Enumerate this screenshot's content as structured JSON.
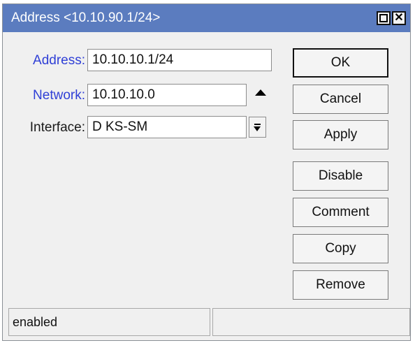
{
  "window": {
    "title": "Address <10.10.90.1/24>",
    "maximize_icon": "maximize-icon",
    "close_icon": "close-icon",
    "close_glyph": "✕"
  },
  "form": {
    "address": {
      "label": "Address:",
      "value": "10.10.10.1/24"
    },
    "network": {
      "label": "Network:",
      "value": "10.10.10.0",
      "toggle_icon": "triangle-up-icon"
    },
    "interface": {
      "label": "Interface:",
      "value": "D KS-SM",
      "dropdown_icon": "dropdown-arrow-icon"
    }
  },
  "buttons": {
    "ok": "OK",
    "cancel": "Cancel",
    "apply": "Apply",
    "disable": "Disable",
    "comment": "Comment",
    "copy": "Copy",
    "remove": "Remove"
  },
  "statusbar": {
    "status": "enabled",
    "secondary": ""
  },
  "colors": {
    "titlebar": "#5b7cbf",
    "label_blue": "#2f3fd6",
    "window_bg": "#f0f0f0"
  }
}
